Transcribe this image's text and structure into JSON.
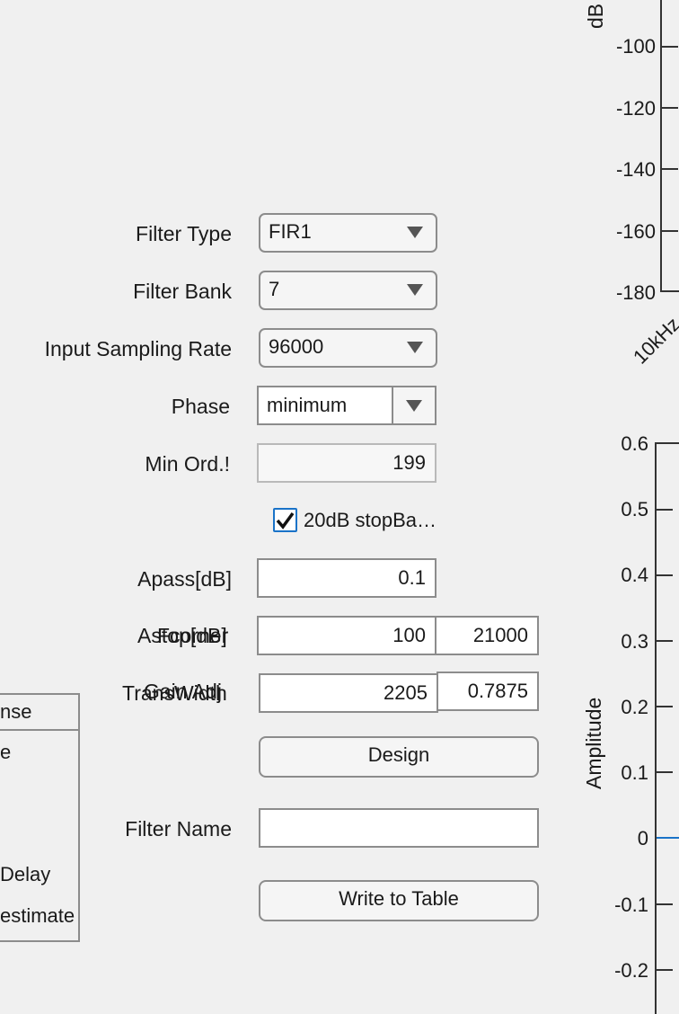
{
  "form": {
    "filter_type": {
      "label": "Filter Type",
      "value": "FIR1"
    },
    "filter_bank": {
      "label": "Filter Bank",
      "value": "7"
    },
    "sampling_rate": {
      "label": "Input Sampling Rate",
      "value": "96000"
    },
    "phase": {
      "label": "Phase",
      "value": "minimum"
    },
    "min_order": {
      "label": "Min Ord.!",
      "value": "199"
    },
    "stopband_check": {
      "label": "20dB stopBa…",
      "checked": true
    },
    "apass": {
      "label": "Apass[dB]",
      "value": "0.1"
    },
    "astop": {
      "label": "Astop[dB]",
      "value": "100"
    },
    "fcorner": {
      "label": "Fcorner",
      "value": "21000"
    },
    "transwidth": {
      "label": "TransWidth",
      "value": "2205"
    },
    "gain_adj": {
      "label": "Gain Adj",
      "value": "0.7875"
    },
    "design_label": "Design",
    "filter_name": {
      "label": "Filter Name",
      "value": ""
    },
    "write_label": "Write to Table"
  },
  "left_panel": {
    "header": "nse",
    "items": [
      "e",
      "Delay",
      "estimate"
    ]
  },
  "top_plot": {
    "ylabel": "dB",
    "ticks": [
      "-100",
      "-120",
      "-140",
      "-160",
      "-180"
    ],
    "xtick": "10kHz"
  },
  "bottom_plot": {
    "ylabel": "Amplitude",
    "ticks": [
      "0.6",
      "0.5",
      "0.4",
      "0.3",
      "0.2",
      "0.1",
      "0",
      "-0.1",
      "-0.2"
    ]
  },
  "colors": {
    "accent": "#1a73c8",
    "border": "#8c8c8c",
    "background": "#f0f0f0"
  }
}
